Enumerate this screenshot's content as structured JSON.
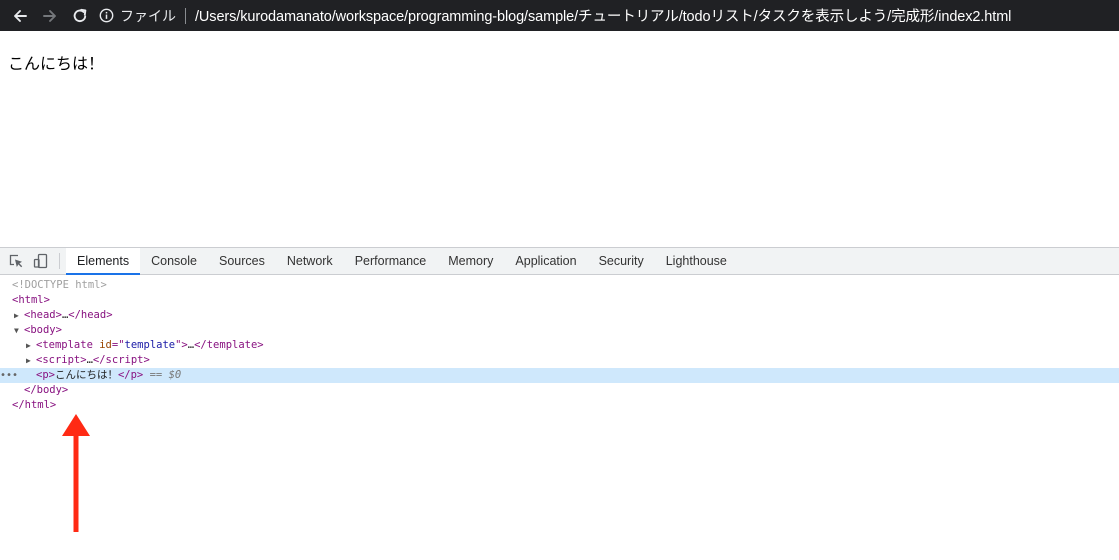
{
  "browser": {
    "scheme_label": "ファイル",
    "url": "/Users/kurodamanato/workspace/programming-blog/sample/チュートリアル/todoリスト/タスクを表示しよう/完成形/index2.html"
  },
  "page": {
    "text": "こんにちは！"
  },
  "devtools": {
    "tabs": [
      "Elements",
      "Console",
      "Sources",
      "Network",
      "Performance",
      "Memory",
      "Application",
      "Security",
      "Lighthouse"
    ],
    "active_tab": "Elements",
    "tree": {
      "doctype": "<!DOCTYPE html>",
      "template_id": "template",
      "p_text": "こんにちは！",
      "console_ref": "$0",
      "ellipsis": "…"
    }
  },
  "colors": {
    "toolbar_bg": "#202124",
    "tab_active_underline": "#1a73e8",
    "selected_row": "#cfe8fc",
    "tag": "#881280",
    "attribute": "#994500",
    "attribute_value": "#1a1aa6",
    "arrow": "#ff2a14"
  },
  "icons": [
    "back-arrow-icon",
    "forward-arrow-icon",
    "reload-icon",
    "info-icon",
    "inspect-element-icon",
    "device-toolbar-icon",
    "expand-triangle-icon",
    "collapse-triangle-icon",
    "annotation-arrow"
  ]
}
